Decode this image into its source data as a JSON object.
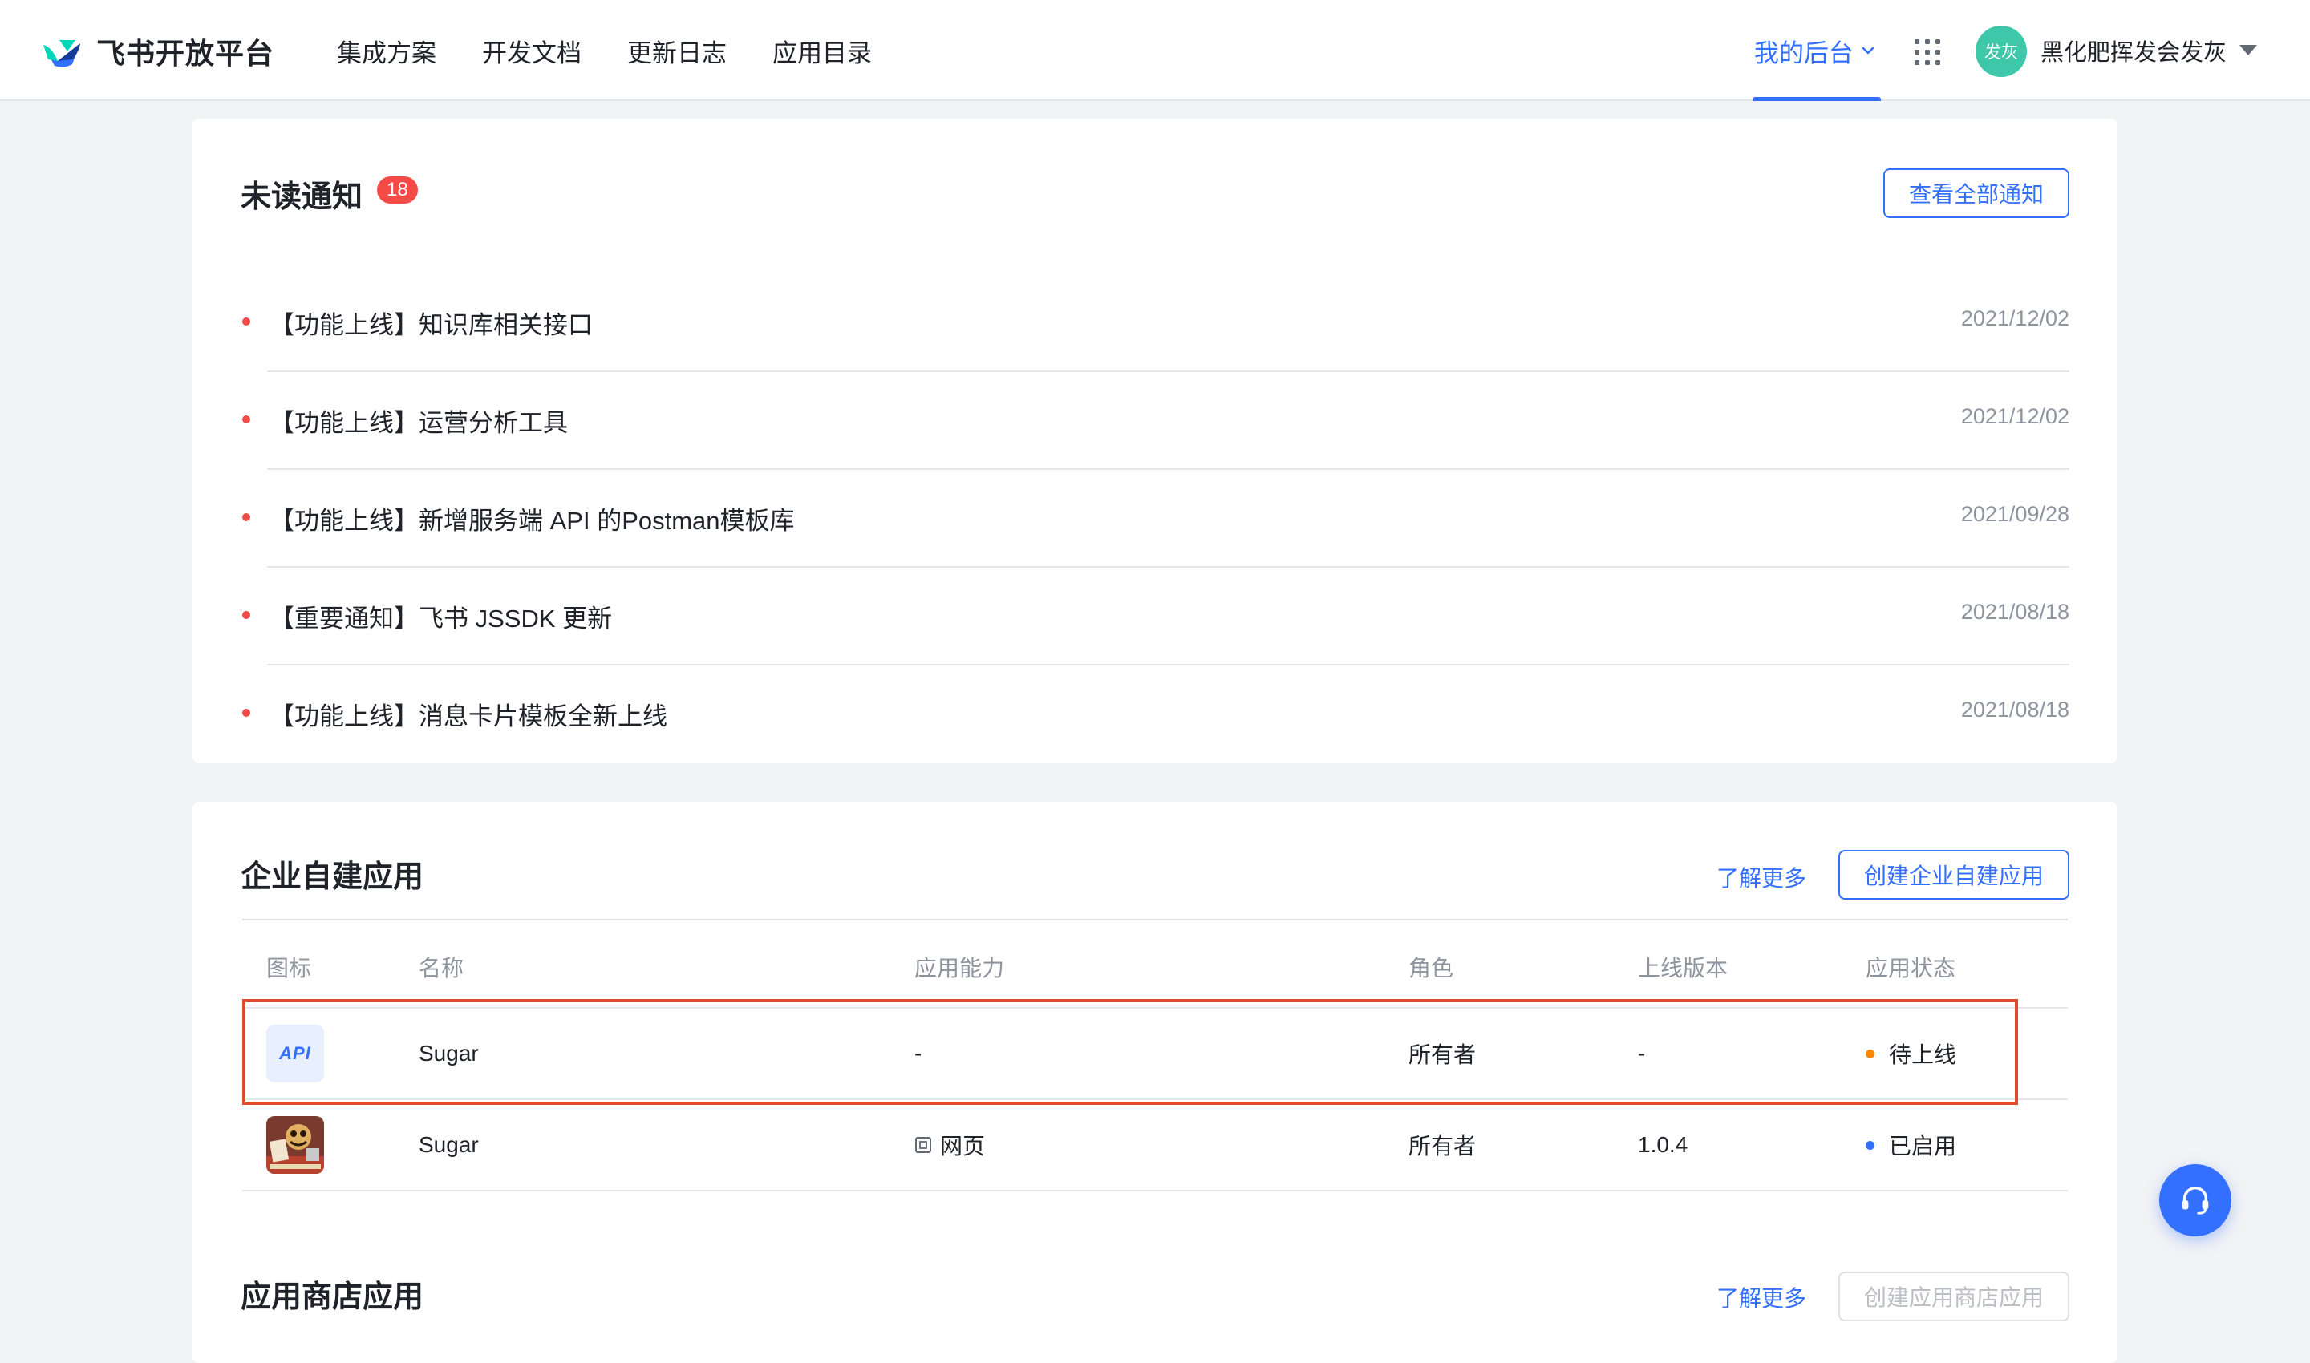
{
  "brand": {
    "name": "飞书开放平台",
    "accent": "#3370ff"
  },
  "nav": {
    "links": [
      "集成方案",
      "开发文档",
      "更新日志",
      "应用目录"
    ],
    "backend": "我的后台",
    "user": {
      "avatar_text": "发灰",
      "name": "黑化肥挥发会发灰"
    }
  },
  "notices": {
    "title": "未读通知",
    "badge": "18",
    "view_all": "查看全部通知",
    "items": [
      {
        "text": "【功能上线】知识库相关接口",
        "date": "2021/12/02"
      },
      {
        "text": "【功能上线】运营分析工具",
        "date": "2021/12/02"
      },
      {
        "text": "【功能上线】新增服务端 API 的Postman模板库",
        "date": "2021/09/28"
      },
      {
        "text": "【重要通知】飞书 JSSDK 更新",
        "date": "2021/08/18"
      },
      {
        "text": "【功能上线】消息卡片模板全新上线",
        "date": "2021/08/18"
      }
    ]
  },
  "custom_apps": {
    "title": "企业自建应用",
    "learn_more": "了解更多",
    "create": "创建企业自建应用",
    "columns": [
      "图标",
      "名称",
      "应用能力",
      "角色",
      "上线版本",
      "应用状态"
    ],
    "rows": [
      {
        "icon": "api-icon",
        "icon_text": "API",
        "name": "Sugar",
        "capability": "-",
        "role": "所有者",
        "version": "-",
        "status": "待上线",
        "status_color": "#ff8800"
      },
      {
        "icon": "game-thumbnail",
        "name": "Sugar",
        "capability": "网页",
        "role": "所有者",
        "version": "1.0.4",
        "status": "已启用",
        "status_color": "#3370ff"
      }
    ]
  },
  "store_apps": {
    "title": "应用商店应用",
    "learn_more": "了解更多",
    "create": "创建应用商店应用"
  }
}
